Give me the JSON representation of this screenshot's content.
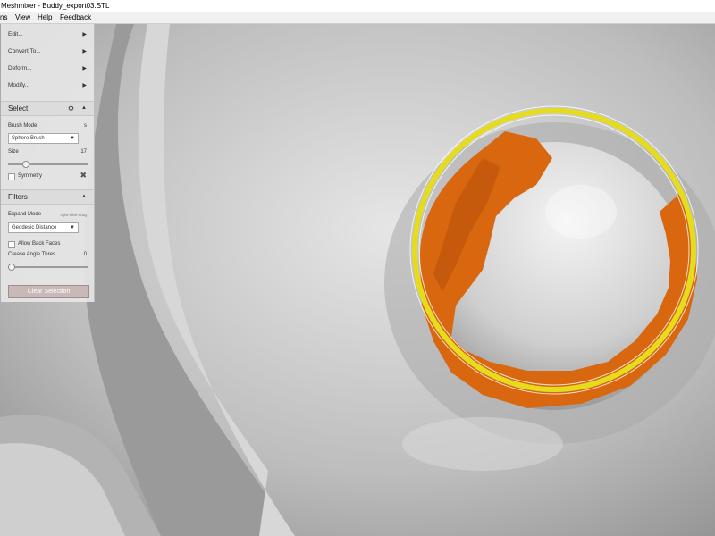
{
  "window": {
    "title": "Meshmixer - Buddy_export03.STL"
  },
  "menu": [
    {
      "label": "ns"
    },
    {
      "label": "View"
    },
    {
      "label": "Help"
    },
    {
      "label": "Feedback"
    }
  ],
  "edit_menu": [
    {
      "label": "Edit..."
    },
    {
      "label": "Convert To..."
    },
    {
      "label": "Deform..."
    },
    {
      "label": "Modify..."
    }
  ],
  "select": {
    "title": "Select",
    "brush_mode_label": "Brush Mode",
    "brush_mode_hint": "s",
    "brush_mode_value": "Sphere Brush",
    "size_label": "Size",
    "size_value": "17",
    "size_fraction": 0.19,
    "symmetry_label": "Symmetry",
    "symmetry_checked": false
  },
  "filters": {
    "title": "Filters",
    "expand_mode_label": "Expand Mode",
    "expand_mode_hint": "right-click-drag",
    "expand_mode_value": "Geodesic Distance",
    "allow_back_faces_label": "Allow Back Faces",
    "allow_back_faces_checked": false,
    "crease_angle_label": "Crease Angle Thres",
    "crease_angle_value": "0",
    "crease_fraction": 0.0
  },
  "clear_selection_label": "Clear Selection",
  "colors": {
    "selection": "#d9670f",
    "brush_ring": "#e6dc1e",
    "mesh": "#c8c8c8"
  }
}
